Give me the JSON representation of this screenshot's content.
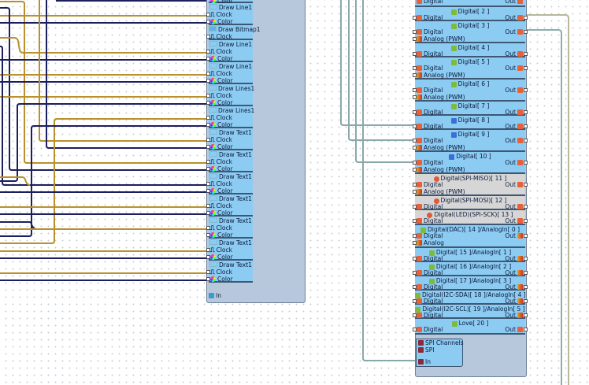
{
  "colors": {
    "clock_wire": "#b8912e",
    "color_wire": "#1c1f5e",
    "digital_wire": "#8aa8a8",
    "out_wire_a": "#b8b89a",
    "out_wire_b": "#8aaeb0",
    "block": "#8ccbf2",
    "block_disabled": "#d6d6d6",
    "container": "#b7c8dc"
  },
  "left": {
    "top_partial_pin": "Color",
    "blocks": [
      {
        "title": "Draw Line1",
        "icon": "line-icon",
        "pins": [
          "Clock",
          "Color"
        ]
      },
      {
        "title": "Draw Bitmap1",
        "icon": "bitmap-icon",
        "pins": [
          "Clock"
        ]
      },
      {
        "title": "Draw Line1",
        "icon": "line-icon",
        "pins": [
          "Clock",
          "Color"
        ]
      },
      {
        "title": "Draw Line1",
        "icon": "line-icon",
        "pins": [
          "Clock",
          "Color"
        ]
      },
      {
        "title": "Draw Lines1",
        "icon": "lines-icon",
        "pins": [
          "Clock",
          "Color"
        ]
      },
      {
        "title": "Draw Lines1",
        "icon": "lines-icon",
        "pins": [
          "Clock",
          "Color"
        ]
      },
      {
        "title": "Draw Text1",
        "icon": "text-icon",
        "pins": [
          "Clock",
          "Color"
        ]
      },
      {
        "title": "Draw Text1",
        "icon": "text-icon",
        "pins": [
          "Clock",
          "Color"
        ]
      },
      {
        "title": "Draw Text1",
        "icon": "text-icon",
        "pins": [
          "Clock",
          "Color"
        ]
      },
      {
        "title": "Draw Text1",
        "icon": "text-icon",
        "pins": [
          "Clock",
          "Color"
        ]
      },
      {
        "title": "Draw Text1",
        "icon": "text-icon",
        "pins": [
          "Clock",
          "Color"
        ]
      },
      {
        "title": "Draw Text1",
        "icon": "text-icon",
        "pins": [
          "Clock",
          "Color"
        ]
      },
      {
        "title": "Draw Text1",
        "icon": "text-icon",
        "pins": [
          "Clock",
          "Color"
        ]
      }
    ],
    "in_label": "In"
  },
  "right": {
    "top_partial": {
      "pin": "Digital",
      "out": "Out"
    },
    "blocks": [
      {
        "title": "Digital[ 2 ]",
        "pins": [
          "Digital"
        ],
        "out": "Out",
        "disabled": false
      },
      {
        "title": "Digital[ 3 ]",
        "pins": [
          "Digital",
          "Analog (PWM)"
        ],
        "out": "Out",
        "disabled": false
      },
      {
        "title": "Digital[ 4 ]",
        "pins": [
          "Digital"
        ],
        "out": "Out",
        "disabled": false
      },
      {
        "title": "Digital[ 5 ]",
        "pins": [
          "Digital",
          "Analog (PWM)"
        ],
        "out": "Out",
        "disabled": false
      },
      {
        "title": "Digital[ 6 ]",
        "pins": [
          "Digital",
          "Analog (PWM)"
        ],
        "out": "Out",
        "disabled": false
      },
      {
        "title": "Digital[ 7 ]",
        "pins": [
          "Digital"
        ],
        "out": "Out",
        "disabled": false
      },
      {
        "title": "Digital[ 8 ]",
        "pins": [
          "Digital"
        ],
        "out": "Out",
        "disabled": false
      },
      {
        "title": "Digital[ 9 ]",
        "pins": [
          "Digital",
          "Analog (PWM)"
        ],
        "out": "Out",
        "disabled": false
      },
      {
        "title": "Digital[ 10 ]",
        "pins": [
          "Digital",
          "Analog (PWM)"
        ],
        "out": "Out",
        "disabled": false
      },
      {
        "title": "Digital(SPI-MISO)[ 11 ]",
        "pins": [
          "Digital",
          "Analog (PWM)"
        ],
        "out": "Out",
        "disabled": true
      },
      {
        "title": "Digital(SPI-MOSI)[ 12 ]",
        "pins": [
          "Digital"
        ],
        "out": "Out",
        "disabled": true
      },
      {
        "title": "Digital(LED)(SPI-SCK)[ 13 ]",
        "pins": [
          "Digital"
        ],
        "out": "Out",
        "disabled": true
      },
      {
        "title": "Digital(DAC)[ 14 ]/AnalogIn[ 0 ]",
        "pins": [
          "Digital",
          "Analog"
        ],
        "out": "Out",
        "disabled": false
      },
      {
        "title": "Digital[ 15 ]/AnalogIn[ 1 ]",
        "pins": [
          "Digital"
        ],
        "out": "Out",
        "disabled": false
      },
      {
        "title": "Digital[ 16 ]/AnalogIn[ 2 ]",
        "pins": [
          "Digital"
        ],
        "out": "Out",
        "disabled": false
      },
      {
        "title": "Digital[ 17 ]/AnalogIn[ 3 ]",
        "pins": [
          "Digital"
        ],
        "out": "Out",
        "disabled": false
      },
      {
        "title": "Digital(I2C-SDA)[ 18 ]/AnalogIn[ 4 ]",
        "pins": [
          "Digital"
        ],
        "out": "Out",
        "disabled": false
      },
      {
        "title": "Digital(I2C-SCL)[ 19 ]/AnalogIn[ 5 ]",
        "pins": [
          "Digital"
        ],
        "out": "Out",
        "disabled": false
      },
      {
        "title": "Love[ 20 ]",
        "pins": [
          "Digital"
        ],
        "out": "Out",
        "disabled": false
      }
    ],
    "spi": {
      "title": "SPI Channels",
      "sub": "SPI",
      "in": "In"
    }
  }
}
